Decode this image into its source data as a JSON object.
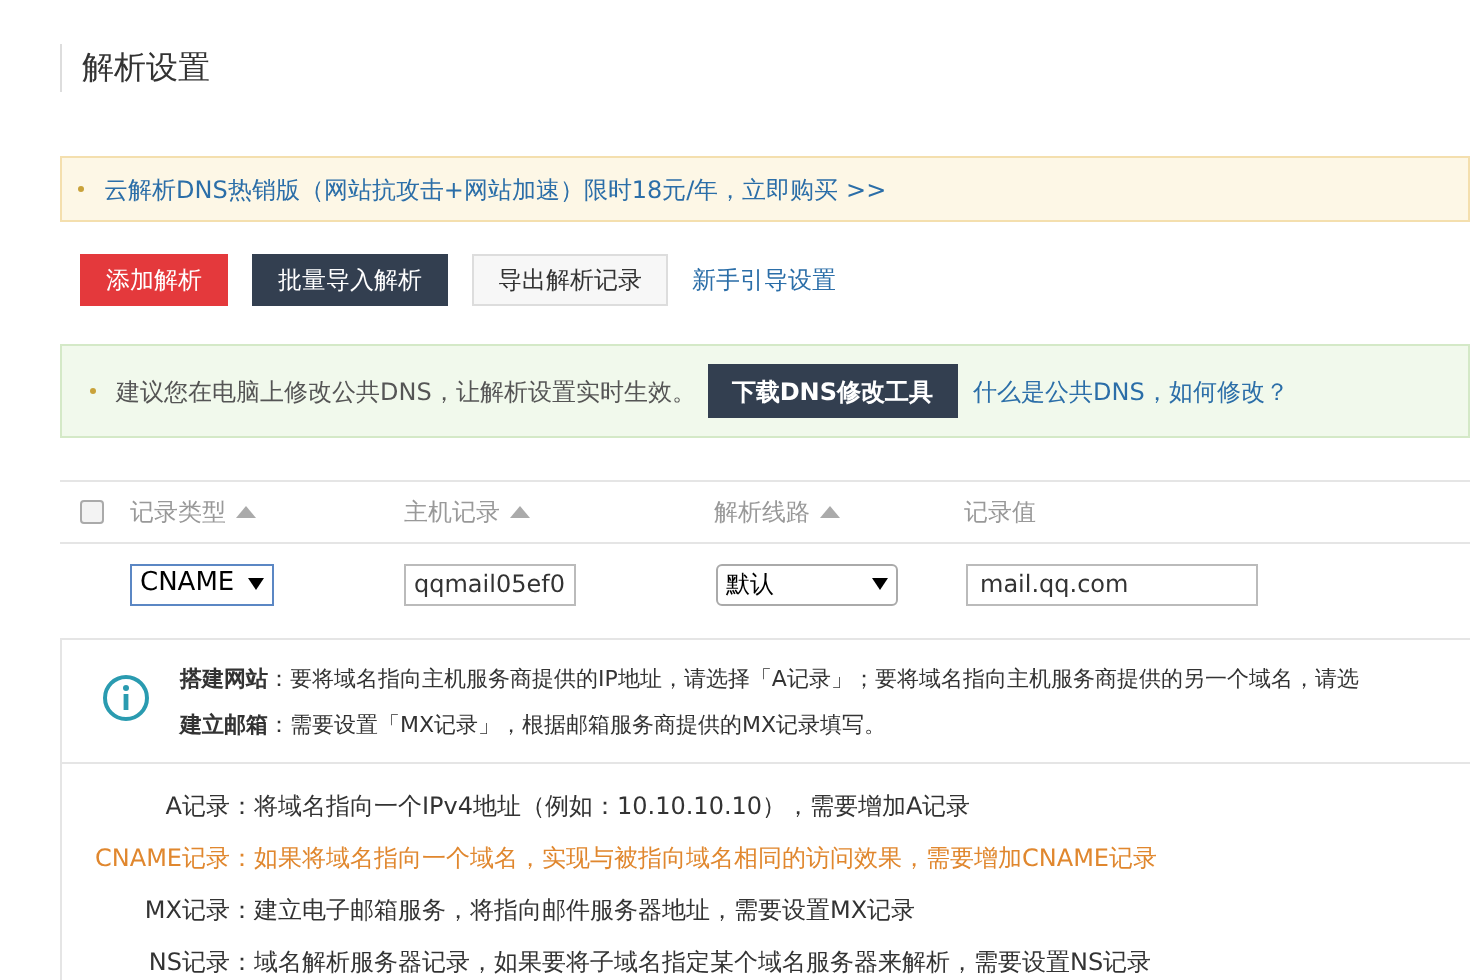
{
  "page_title": "解析设置",
  "promo_banner": {
    "text": "云解析DNS热销版（网站抗攻击+网站加速）限时18元/年，立即购买 >>"
  },
  "toolbar": [
    {
      "kind": "danger",
      "label": "添加解析"
    },
    {
      "kind": "dark",
      "label": "批量导入解析"
    },
    {
      "kind": "plain",
      "label": "导出解析记录"
    },
    {
      "kind": "link",
      "label": "新手引导设置"
    }
  ],
  "tip_banner": {
    "text": "建议您在电脑上修改公共DNS，让解析设置实时生效。",
    "button": "下载DNS修改工具",
    "link": "什么是公共DNS，如何修改？"
  },
  "table": {
    "select_all": {
      "checked": false
    },
    "columns": [
      {
        "label": "记录类型",
        "sortable": true
      },
      {
        "label": "主机记录",
        "sortable": true
      },
      {
        "label": "解析线路",
        "sortable": true
      },
      {
        "label": "记录值",
        "sortable": false
      }
    ],
    "edit_row": {
      "record_type": "CNAME",
      "host": "qqmail05ef0",
      "line": "默认",
      "value": "mail.qq.com"
    }
  },
  "help": {
    "notes": [
      "**搭建网站**：要将域名指向主机服务商提供的IP地址，请选择「A记录」；要将域名指向主机服务商提供的另一个域名，请选",
      "**建立邮箱**：需要设置「MX记录」，根据邮箱服务商提供的MX记录填写。"
    ],
    "record_types": [
      {
        "label": "A记录：",
        "text": "将域名指向一个IPv4地址（例如：10.10.10.10），需要增加A记录",
        "highlighted": false
      },
      {
        "label": "CNAME记录：",
        "text": "如果将域名指向一个域名，实现与被指向域名相同的访问效果，需要增加CNAME记录",
        "highlighted": true
      },
      {
        "label": "MX记录：",
        "text": "建立电子邮箱服务，将指向邮件服务器地址，需要设置MX记录",
        "highlighted": false
      },
      {
        "label": "NS记录：",
        "text": "域名解析服务器记录，如果要将子域名指定某个域名服务器来解析，需要设置NS记录",
        "highlighted": false
      }
    ]
  }
}
